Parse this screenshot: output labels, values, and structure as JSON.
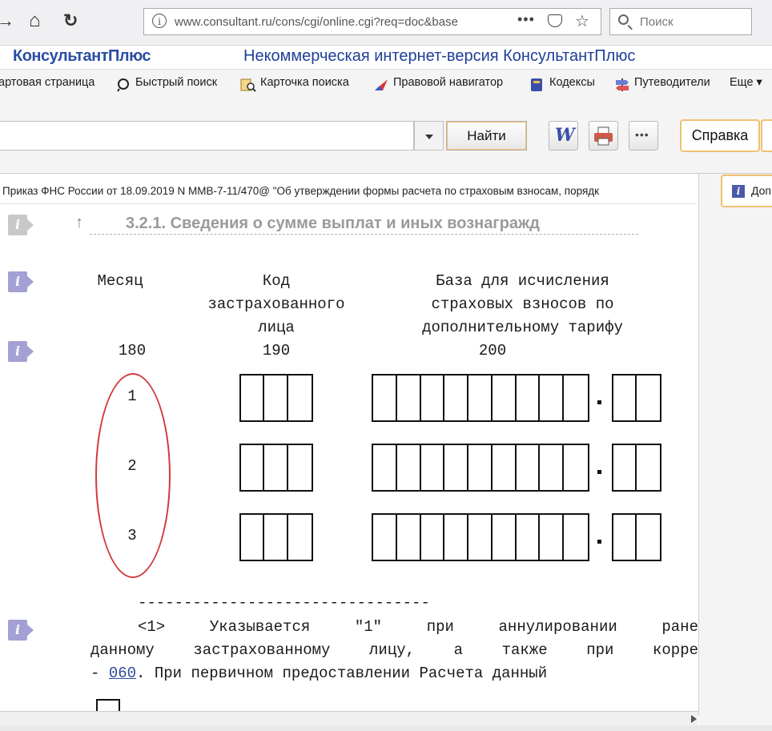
{
  "browser": {
    "url": "www.consultant.ru/cons/cgi/online.cgi?req=doc&base",
    "url_dots": "•••",
    "search_placeholder": "Поиск"
  },
  "site": {
    "logo": "КонсультантПлюс",
    "title": "Некоммерческая интернет-версия КонсультантПлюс"
  },
  "menu": {
    "items": [
      {
        "label": "артовая страница",
        "icon": "home-icon"
      },
      {
        "label": "Быстрый поиск",
        "icon": "search-icon"
      },
      {
        "label": "Карточка поиска",
        "icon": "card-search-icon"
      },
      {
        "label": "Правовой навигатор",
        "icon": "navigator-icon"
      },
      {
        "label": "Кодексы",
        "icon": "codex-icon"
      },
      {
        "label": "Путеводители",
        "icon": "signpost-icon"
      },
      {
        "label": "Еще ▾",
        "icon": ""
      }
    ]
  },
  "toolbar": {
    "find_label": "Найти",
    "word_label": "W",
    "more_label": "•••",
    "help_label": "Справка",
    "side_tab_label": "Доп"
  },
  "document": {
    "title": "Приказ ФНС России от 18.09.2019 N ММВ-7-11/470@ \"Об утверждении формы расчета по страховым взносам, порядк",
    "section_heading": "3.2.1. Сведения о сумме выплат и иных вознагражд",
    "columns": [
      {
        "header": "Месяц",
        "code": "180"
      },
      {
        "header": "Код\nзастрахованного\nлица",
        "code": "190"
      },
      {
        "header": "База для исчисления\nстраховых взносов по\nдополнительному тарифу",
        "code": "200"
      }
    ],
    "rows": [
      "1",
      "2",
      "3"
    ],
    "separator": "--------------------------------",
    "footnote": {
      "line1": "<1> Указывается \"1\" при аннулировании ране",
      "line2": "данному застрахованному лицу, а также при корре",
      "line3_prefix": "- ",
      "line3_link": "060",
      "line3_suffix": ". При первичном предоставлении Расчета данный"
    }
  },
  "colors": {
    "annotation_oval": "#d23a3a",
    "brand_blue": "#1f3f99",
    "info_icon": "#a3a0d4"
  }
}
